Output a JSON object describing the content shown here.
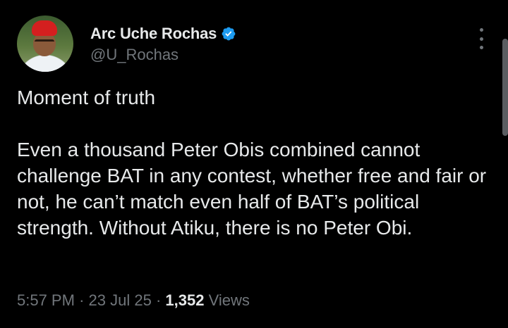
{
  "author": {
    "display_name": "Arc Uche Rochas",
    "handle": "@U_Rochas",
    "verified": true,
    "verified_color": "#1d9bf0"
  },
  "tweet": {
    "line1": "Moment of truth",
    "line2": "Even a thousand Peter Obis combined cannot challenge BAT in any contest, whether free and fair or not, he can’t match even half of BAT’s political strength. Without Atiku, there is no Peter Obi."
  },
  "meta": {
    "time": "5:57 PM",
    "date": "23 Jul 25",
    "separator": "·",
    "views_count": "1,352",
    "views_label": "Views"
  },
  "icons": {
    "verified": "verified-badge-icon",
    "more": "more-options-icon"
  }
}
